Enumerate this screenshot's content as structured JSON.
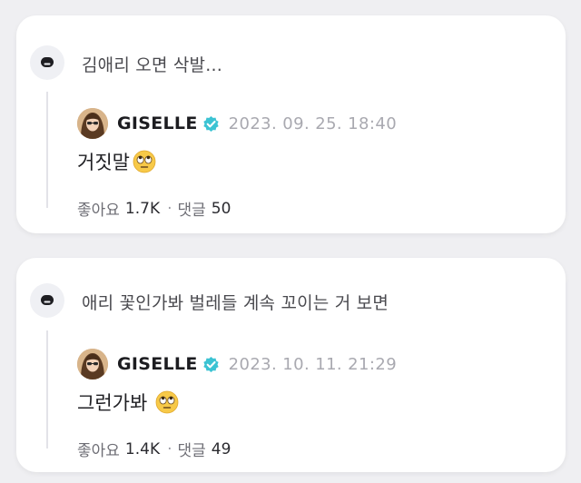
{
  "posts": [
    {
      "question": "김애리 오면 삭발...",
      "reply": {
        "artist": "GISELLE",
        "timestamp": "2023. 09. 25. 18:40",
        "message": "거짓말",
        "emoji": "face-with-rolling-eyes-emoji",
        "likes_label": "좋아요",
        "likes": "1.7K",
        "comments_label": "댓글",
        "comments": "50"
      }
    },
    {
      "question": "애리 꽃인가봐 벌레들 계속 꼬이는 거 보면",
      "reply": {
        "artist": "GISELLE",
        "timestamp": "2023. 10. 11. 21:29",
        "message": "그런가봐",
        "emoji": "face-with-rolling-eyes-emoji",
        "likes_label": "좋아요",
        "likes": "1.4K",
        "comments_label": "댓글",
        "comments": "49"
      }
    }
  ],
  "separator": "·",
  "colors": {
    "background": "#efeff2",
    "card": "#ffffff",
    "verified_badge": "#3cc3d3",
    "timestamp": "#a9a9b0"
  },
  "icons": {
    "question_avatar": "chat-bubble-icon",
    "verified": "verified-badge-icon"
  }
}
